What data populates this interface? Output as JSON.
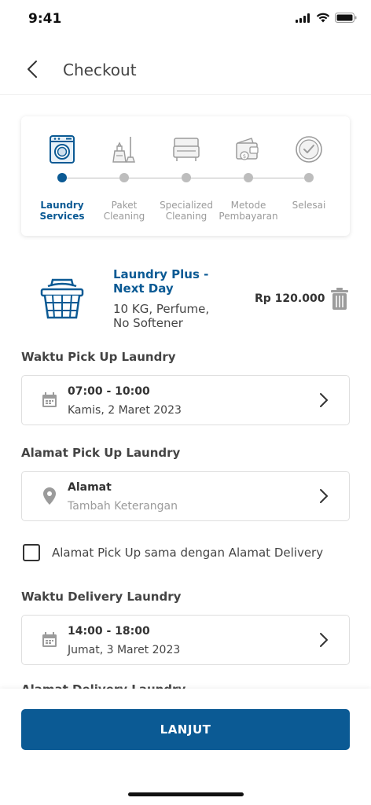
{
  "status_bar": {
    "time": "9:41"
  },
  "header": {
    "title": "Checkout"
  },
  "stepper": {
    "steps": [
      {
        "label_line1": "Laundry",
        "label_line2": "Services",
        "icon": "washing-machine-icon",
        "active": true
      },
      {
        "label_line1": "Paket",
        "label_line2": "Cleaning",
        "icon": "cleaning-supplies-icon",
        "active": false
      },
      {
        "label_line1": "Specialized",
        "label_line2": "Cleaning",
        "icon": "sofa-icon",
        "active": false
      },
      {
        "label_line1": "Metode",
        "label_line2": "Pembayaran",
        "icon": "wallet-icon",
        "active": false
      },
      {
        "label_line1": "Selesai",
        "label_line2": "",
        "icon": "check-circle-icon",
        "active": false
      }
    ]
  },
  "cart_item": {
    "name_line1": "Laundry Plus -",
    "name_line2": "Next Day",
    "desc_line1": "10 KG, Perfume,",
    "desc_line2": "No Softener",
    "price": "Rp 120.000",
    "icon": "laundry-basket-icon"
  },
  "pickup_time": {
    "section_title": "Waktu Pick Up Laundry",
    "time": "07:00 - 10:00",
    "date": "Kamis, 2 Maret 2023"
  },
  "pickup_address": {
    "section_title": "Alamat Pick Up Laundry",
    "title": "Alamat",
    "placeholder": "Tambah Keterangan"
  },
  "same_address_checkbox": {
    "label": "Alamat Pick Up sama dengan Alamat Delivery",
    "checked": false
  },
  "delivery_time": {
    "section_title": "Waktu Delivery Laundry",
    "time": "14:00 - 18:00",
    "date": "Jumat, 3 Maret 2023"
  },
  "delivery_address": {
    "section_title": "Alamat Delivery Laundry"
  },
  "footer": {
    "button_label": "LANJUT"
  },
  "colors": {
    "primary": "#0b5a94",
    "muted": "#9b9b9b",
    "inactive": "#bdbdbd"
  }
}
